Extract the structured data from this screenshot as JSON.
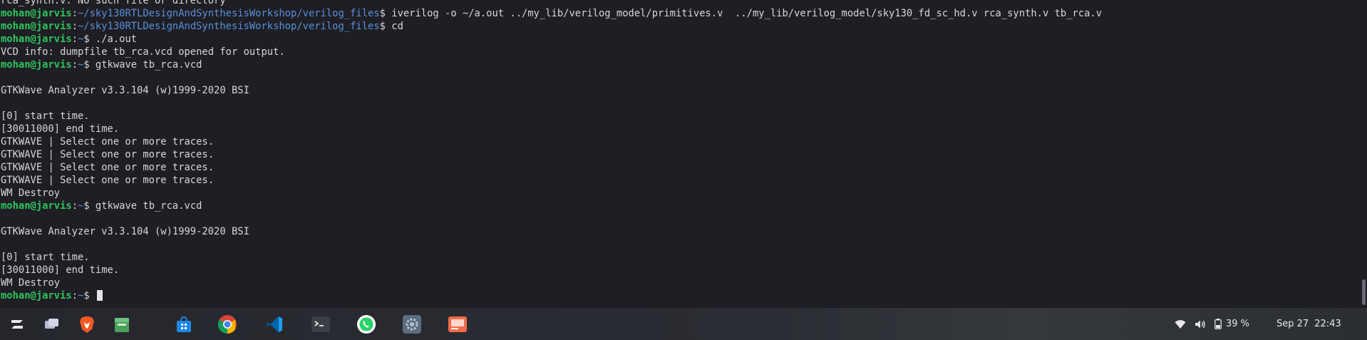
{
  "terminal": {
    "lines": [
      {
        "type": "output",
        "text": "rca_synth.v: No such file or directory"
      },
      {
        "type": "prompt",
        "user": "mohan@jarvis",
        "path": "~/sky130RTLDesignAndSynthesisWorkshop/verilog_files",
        "cmd": " iverilog -o ~/a.out ../my_lib/verilog_model/primitives.v  ../my_lib/verilog_model/sky130_fd_sc_hd.v rca_synth.v tb_rca.v"
      },
      {
        "type": "prompt",
        "user": "mohan@jarvis",
        "path": "~/sky130RTLDesignAndSynthesisWorkshop/verilog_files",
        "cmd": " cd"
      },
      {
        "type": "prompt",
        "user": "mohan@jarvis",
        "path": "~",
        "cmd": " ./a.out"
      },
      {
        "type": "output",
        "text": "VCD info: dumpfile tb_rca.vcd opened for output."
      },
      {
        "type": "prompt",
        "user": "mohan@jarvis",
        "path": "~",
        "cmd": " gtkwave tb_rca.vcd"
      },
      {
        "type": "output",
        "text": ""
      },
      {
        "type": "output",
        "text": "GTKWave Analyzer v3.3.104 (w)1999-2020 BSI"
      },
      {
        "type": "output",
        "text": ""
      },
      {
        "type": "output",
        "text": "[0] start time."
      },
      {
        "type": "output",
        "text": "[30011000] end time."
      },
      {
        "type": "output",
        "text": "GTKWAVE | Select one or more traces."
      },
      {
        "type": "output",
        "text": "GTKWAVE | Select one or more traces."
      },
      {
        "type": "output",
        "text": "GTKWAVE | Select one or more traces."
      },
      {
        "type": "output",
        "text": "GTKWAVE | Select one or more traces."
      },
      {
        "type": "output",
        "text": "WM Destroy"
      },
      {
        "type": "prompt",
        "user": "mohan@jarvis",
        "path": "~",
        "cmd": " gtkwave tb_rca.vcd"
      },
      {
        "type": "output",
        "text": ""
      },
      {
        "type": "output",
        "text": "GTKWave Analyzer v3.3.104 (w)1999-2020 BSI"
      },
      {
        "type": "output",
        "text": ""
      },
      {
        "type": "output",
        "text": "[0] start time."
      },
      {
        "type": "output",
        "text": "[30011000] end time."
      },
      {
        "type": "output",
        "text": "WM Destroy"
      },
      {
        "type": "prompt",
        "user": "mohan@jarvis",
        "path": "~",
        "cmd": " ",
        "cursor": true
      }
    ]
  },
  "taskbar": {
    "apps": [
      {
        "name": "zorin-menu-icon"
      },
      {
        "name": "workspaces-icon"
      },
      {
        "name": "brave-browser-icon"
      },
      {
        "name": "files-icon"
      },
      {
        "name": "software-store-icon"
      },
      {
        "name": "chrome-icon"
      },
      {
        "name": "vscode-icon"
      },
      {
        "name": "terminal-icon"
      },
      {
        "name": "whatsapp-icon"
      },
      {
        "name": "settings-icon"
      },
      {
        "name": "screenshot-tool-icon"
      }
    ],
    "tray": {
      "battery": "39 %",
      "date": "Sep 27",
      "time": "22:43"
    }
  },
  "colors": {
    "user": "#2fc45c",
    "path": "#5b8fd9",
    "text": "#d6d6da",
    "background": "#1e1e24"
  }
}
